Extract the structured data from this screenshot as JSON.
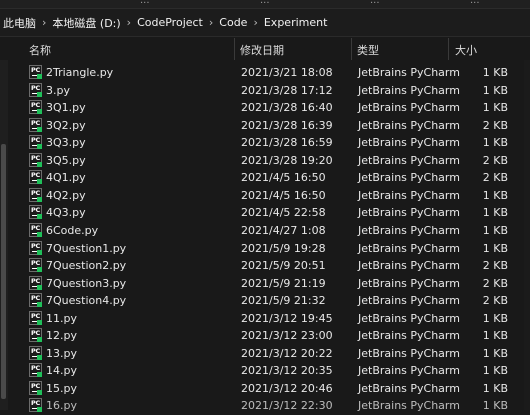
{
  "ribbon": {
    "labels": [
      "...",
      "...",
      "...",
      "..."
    ]
  },
  "address_bar": {
    "crumbs": [
      "此电脑",
      "本地磁盘 (D:)",
      "CodeProject",
      "Code",
      "Experiment"
    ]
  },
  "columns": {
    "name": "名称",
    "date": "修改日期",
    "type": "类型",
    "size": "大小"
  },
  "icon": {
    "name": "pycharm-file-icon",
    "label": "PC",
    "accent": "#20c05a"
  },
  "files": [
    {
      "name": "2Triangle.py",
      "date": "2021/3/21 18:08",
      "type": "JetBrains PyCharm",
      "size": "1 KB"
    },
    {
      "name": "3.py",
      "date": "2021/3/28 17:12",
      "type": "JetBrains PyCharm",
      "size": "1 KB"
    },
    {
      "name": "3Q1.py",
      "date": "2021/3/28 16:40",
      "type": "JetBrains PyCharm",
      "size": "1 KB"
    },
    {
      "name": "3Q2.py",
      "date": "2021/3/28 16:39",
      "type": "JetBrains PyCharm",
      "size": "2 KB"
    },
    {
      "name": "3Q3.py",
      "date": "2021/3/28 16:59",
      "type": "JetBrains PyCharm",
      "size": "1 KB"
    },
    {
      "name": "3Q5.py",
      "date": "2021/3/28 19:20",
      "type": "JetBrains PyCharm",
      "size": "2 KB"
    },
    {
      "name": "4Q1.py",
      "date": "2021/4/5 16:50",
      "type": "JetBrains PyCharm",
      "size": "2 KB"
    },
    {
      "name": "4Q2.py",
      "date": "2021/4/5 16:50",
      "type": "JetBrains PyCharm",
      "size": "1 KB"
    },
    {
      "name": "4Q3.py",
      "date": "2021/4/5 22:58",
      "type": "JetBrains PyCharm",
      "size": "1 KB"
    },
    {
      "name": "6Code.py",
      "date": "2021/4/27 1:08",
      "type": "JetBrains PyCharm",
      "size": "1 KB"
    },
    {
      "name": "7Question1.py",
      "date": "2021/5/9 19:28",
      "type": "JetBrains PyCharm",
      "size": "1 KB"
    },
    {
      "name": "7Question2.py",
      "date": "2021/5/9 20:51",
      "type": "JetBrains PyCharm",
      "size": "2 KB"
    },
    {
      "name": "7Question3.py",
      "date": "2021/5/9 21:19",
      "type": "JetBrains PyCharm",
      "size": "2 KB"
    },
    {
      "name": "7Question4.py",
      "date": "2021/5/9 21:32",
      "type": "JetBrains PyCharm",
      "size": "2 KB"
    },
    {
      "name": "11.py",
      "date": "2021/3/12 19:45",
      "type": "JetBrains PyCharm",
      "size": "1 KB"
    },
    {
      "name": "12.py",
      "date": "2021/3/12 23:00",
      "type": "JetBrains PyCharm",
      "size": "1 KB"
    },
    {
      "name": "13.py",
      "date": "2021/3/12 20:22",
      "type": "JetBrains PyCharm",
      "size": "1 KB"
    },
    {
      "name": "14.py",
      "date": "2021/3/12 20:35",
      "type": "JetBrains PyCharm",
      "size": "1 KB"
    },
    {
      "name": "15.py",
      "date": "2021/3/12 20:46",
      "type": "JetBrains PyCharm",
      "size": "1 KB"
    },
    {
      "name": "16.py",
      "date": "2021/3/12 22:30",
      "type": "JetBrains PyCharm",
      "size": "1 KB"
    }
  ]
}
